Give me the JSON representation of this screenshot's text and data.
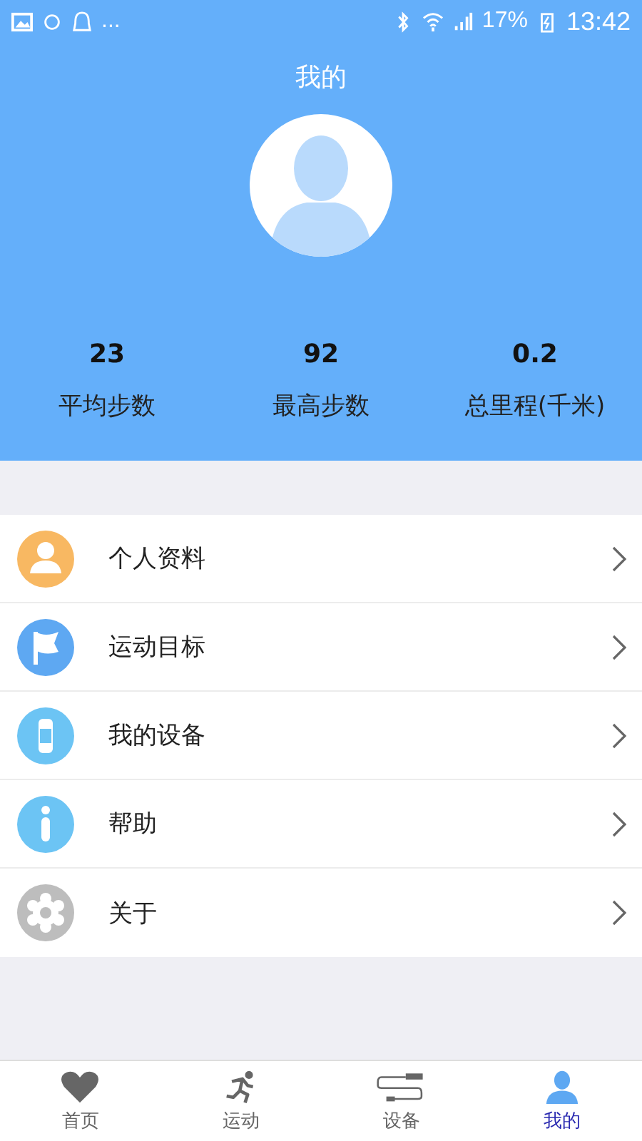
{
  "status_bar": {
    "more": "...",
    "battery": "17%",
    "time": "13:42"
  },
  "header": {
    "title": "我的"
  },
  "stats": [
    {
      "value": "23",
      "label": "平均步数"
    },
    {
      "value": "92",
      "label": "最高步数"
    },
    {
      "value": "0.2",
      "label": "总里程(千米)"
    }
  ],
  "menu": [
    {
      "kind": "profile",
      "label": "个人资料",
      "color": "#f8b862"
    },
    {
      "kind": "goal",
      "label": "运动目标",
      "color": "#5ea8f2"
    },
    {
      "kind": "device",
      "label": "我的设备",
      "color": "#6cc4f4"
    },
    {
      "kind": "help",
      "label": "帮助",
      "color": "#6cc4f4"
    },
    {
      "kind": "about",
      "label": "关于",
      "color": "#bdbdbd"
    }
  ],
  "tabs": [
    {
      "kind": "home",
      "label": "首页",
      "selected": false
    },
    {
      "kind": "sport",
      "label": "运动",
      "selected": false
    },
    {
      "kind": "device",
      "label": "设备",
      "selected": false
    },
    {
      "kind": "me",
      "label": "我的",
      "selected": true
    }
  ]
}
